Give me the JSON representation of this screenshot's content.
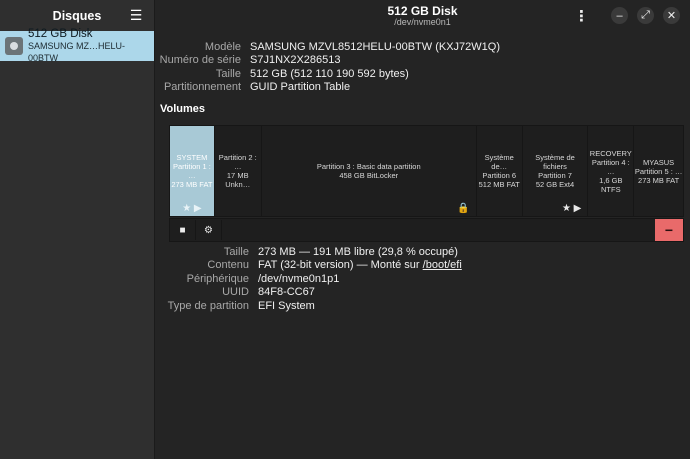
{
  "sidebar": {
    "title": "Disques",
    "menu_icon": "hamburger-icon",
    "disks": [
      {
        "name": "512 GB Disk",
        "model": "SAMSUNG MZ…HELU-00BTW",
        "icon": "disk-icon"
      }
    ]
  },
  "header": {
    "title": "512 GB Disk",
    "subtitle": "/dev/nvme0n1",
    "kebab_glyph": "⋮",
    "minimize_glyph": "–",
    "maximize_glyph": "⤢",
    "close_glyph": "✕"
  },
  "disk_info": {
    "rows": [
      {
        "label": "Modèle",
        "value": "SAMSUNG MZVL8512HELU-00BTW (KXJ72W1Q)"
      },
      {
        "label": "Numéro de série",
        "value": "S7J1NX2X286513"
      },
      {
        "label": "Taille",
        "value": "512 GB (512 110 190 592 bytes)"
      },
      {
        "label": "Partitionnement",
        "value": "GUID Partition Table"
      }
    ]
  },
  "volumes": {
    "title": "Volumes",
    "partitions": [
      {
        "line1": "SYSTEM",
        "line2": "Partition 1 : …",
        "line3": "273 MB FAT",
        "selected": true,
        "marks": "★ ▶"
      },
      {
        "line1": "Partition 2 : …",
        "line2": "17 MB Unkn…",
        "line3": "",
        "selected": false,
        "marks": ""
      },
      {
        "line1": "Partition 3 : Basic data partition",
        "line2": "458 GB BitLocker",
        "line3": "",
        "selected": false,
        "marks": "🔒"
      },
      {
        "line1": "Système de…",
        "line2": "Partition 6",
        "line3": "512 MB FAT",
        "selected": false,
        "marks": ""
      },
      {
        "line1": "Système de fichiers",
        "line2": "Partition 7",
        "line3": "52 GB Ext4",
        "selected": false,
        "marks": "★ ▶"
      },
      {
        "line1": "RECOVERY",
        "line2": "Partition 4 : …",
        "line3": "1,6 GB NTFS",
        "selected": false,
        "marks": ""
      },
      {
        "line1": "MYASUS",
        "line2": "Partition 5 : …",
        "line3": "273 MB FAT",
        "selected": false,
        "marks": ""
      }
    ],
    "toolbar": {
      "stop_glyph": "■",
      "gear_glyph": "⚙",
      "remove_glyph": "−"
    }
  },
  "partition_details": {
    "size_label": "Taille",
    "size_value": "273 MB — 191 MB libre (29,8 % occupé)",
    "content_label": "Contenu",
    "content_value": "FAT (32-bit version) — Monté sur ",
    "content_link": "/boot/efi",
    "device_label": "Périphérique",
    "device_value": "/dev/nvme0n1p1",
    "uuid_label": "UUID",
    "uuid_value": "84F8-CC67",
    "type_label": "Type de partition",
    "type_value": "EFI System"
  },
  "colors": {
    "accent": "#acd7ea",
    "selected_partition": "#a8c9d6",
    "remove_button": "#e96a6a",
    "background": "#242424",
    "sidebar": "#2f2f2f"
  }
}
